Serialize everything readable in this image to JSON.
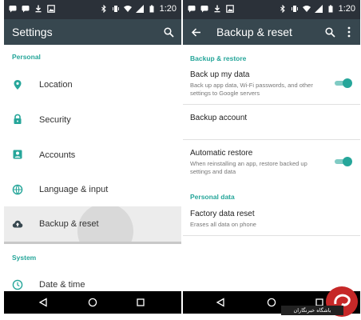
{
  "status_bar": {
    "time_left": "1:20",
    "time_right": "1:20"
  },
  "left_screen": {
    "title": "Settings",
    "sections": {
      "personal": "Personal",
      "system": "System"
    },
    "items": [
      {
        "label": "Location",
        "icon": "location-pin-icon"
      },
      {
        "label": "Security",
        "icon": "lock-icon"
      },
      {
        "label": "Accounts",
        "icon": "account-icon"
      },
      {
        "label": "Language & input",
        "icon": "globe-icon"
      },
      {
        "label": "Backup & reset",
        "icon": "cloud-upload-icon",
        "pressed": true
      },
      {
        "label": "Date & time",
        "icon": "clock-icon"
      }
    ]
  },
  "right_screen": {
    "title": "Backup & reset",
    "sections": {
      "backup_restore": "Backup & restore",
      "personal_data": "Personal data"
    },
    "items": {
      "backup_my_data": {
        "title": "Back up my data",
        "subtitle": "Back up app data, Wi-Fi passwords, and other settings to Google servers",
        "toggle_on": true
      },
      "backup_account": {
        "title": "Backup account"
      },
      "automatic_restore": {
        "title": "Automatic restore",
        "subtitle": "When reinstalling an app, restore backed up settings and data",
        "toggle_on": true
      },
      "factory_reset": {
        "title": "Factory data reset",
        "subtitle": "Erases all data on phone"
      }
    }
  },
  "watermark": {
    "text": "باشگاه خبرنگاران"
  },
  "colors": {
    "status_bar": "#2b3139",
    "app_bar": "#37474f",
    "accent": "#26a69a",
    "nav_bar": "#000000"
  }
}
